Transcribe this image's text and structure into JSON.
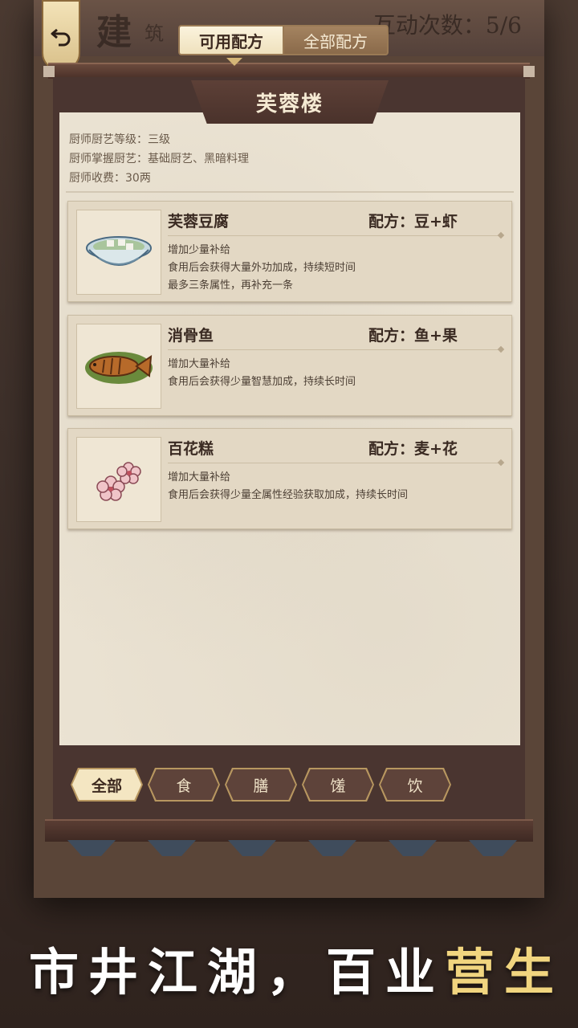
{
  "header": {
    "bg_title": "建",
    "bg_title_small": "筑",
    "counter": "互动次数：5/6"
  },
  "tabs": [
    {
      "label": "可用配方"
    },
    {
      "label": "全部配方"
    }
  ],
  "restaurant": {
    "name": "芙蓉楼"
  },
  "chef": {
    "level": "厨师厨艺等级：三级",
    "skills": "厨师掌握厨艺：基础厨艺、黑暗料理",
    "fee": "厨师收费：30两"
  },
  "recipes": [
    {
      "name": "芙蓉豆腐",
      "formula": "配方：豆+虾",
      "icon": "tofu-soup-icon",
      "desc": [
        "增加少量补给",
        "食用后会获得大量外功加成，持续短时间",
        "最多三条属性，再补充一条"
      ]
    },
    {
      "name": "消骨鱼",
      "formula": "配方：鱼+果",
      "icon": "fish-dish-icon",
      "desc": [
        "增加大量补给",
        "食用后会获得少量智慧加成，持续长时间"
      ]
    },
    {
      "name": "百花糕",
      "formula": "配方：麦+花",
      "icon": "flower-cake-icon",
      "desc": [
        "增加大量补给",
        "食用后会获得少量全属性经验获取加成，持续长时间"
      ]
    }
  ],
  "filters": [
    {
      "label": "全部",
      "active": true
    },
    {
      "label": "食",
      "active": false
    },
    {
      "label": "膳",
      "active": false
    },
    {
      "label": "馐",
      "active": false
    },
    {
      "label": "饮",
      "active": false
    }
  ],
  "slogan": {
    "main": "市井江湖，百业",
    "highlight": "营生"
  },
  "colors": {
    "accent_gold": "#f1d57f",
    "paper": "#ebe3d3",
    "frame_brown": "#4a3530"
  }
}
